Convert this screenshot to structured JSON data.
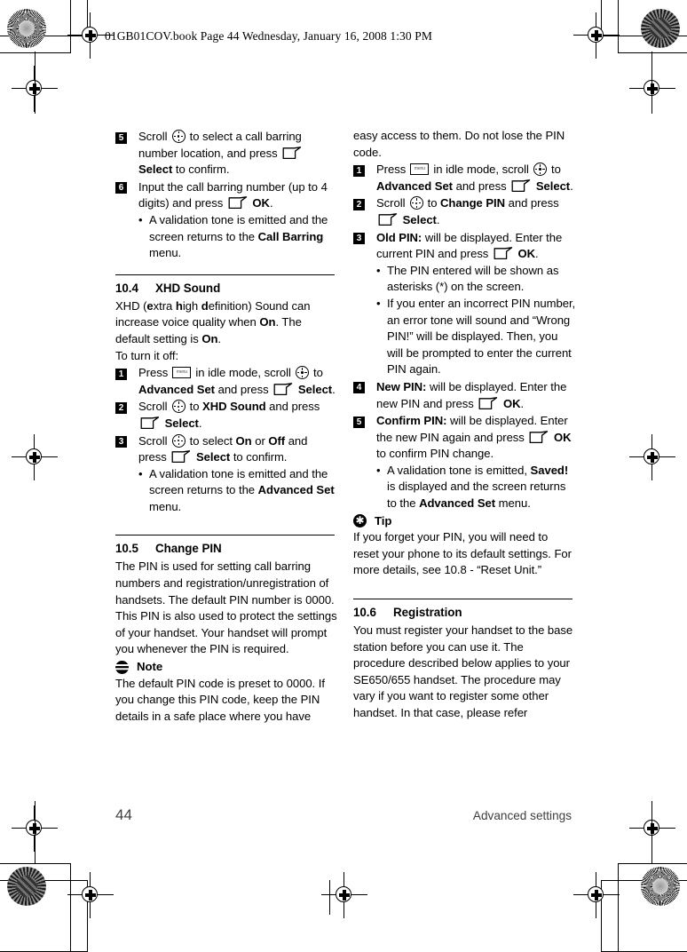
{
  "document": {
    "running_head": "01GB01COV.book  Page 44  Wednesday, January 16, 2008  1:30 PM",
    "footer": {
      "page_number": "44",
      "chapter_title": "Advanced settings"
    }
  },
  "icons": {
    "scroll": "scroll-key-icon",
    "softkey": "soft-key-icon",
    "menu": "menu-key-icon",
    "note": "note-icon",
    "tip": "tip-icon"
  },
  "left_column": {
    "step5": {
      "number": "5",
      "t1": "Scroll ",
      "t2": " to select a call barring number location, and press ",
      "t3": " ",
      "bold1": "Select",
      "t4": " to confirm."
    },
    "step6": {
      "number": "6",
      "t1": "Input the call barring number (up to 4 digits) and press ",
      "t2": " ",
      "bold1": "OK",
      "t3": ".",
      "bullet1": {
        "marker": "•",
        "t1": "A validation tone is emitted and the screen returns to the ",
        "bold1": "Call Barring",
        "t2": " menu."
      }
    },
    "section_104": {
      "number": "10.4",
      "title": "XHD Sound",
      "intro": {
        "t1": "XHD (",
        "b1": "e",
        "t2": "xtra ",
        "b2": "h",
        "t3": "igh ",
        "b3": "d",
        "t4": "efinition) Sound can increase voice quality when ",
        "b4": "On",
        "t5": ". The default setting is ",
        "b5": "On",
        "t6": "."
      },
      "lead": "To turn it off:",
      "step1": {
        "number": "1",
        "t1": "Press ",
        "t2": " in idle mode, scroll ",
        "t3": " to ",
        "bold1": "Advanced Set",
        "t4": " and press ",
        "t5": " ",
        "bold2": "Select",
        "t6": "."
      },
      "step2": {
        "number": "2",
        "t1": "Scroll ",
        "t2": " to ",
        "bold1": "XHD Sound",
        "t3": " and press ",
        "t4": " ",
        "bold2": "Select",
        "t5": "."
      },
      "step3": {
        "number": "3",
        "t1": "Scroll ",
        "t2": " to select ",
        "bold1": "On",
        "t3": " or ",
        "bold2": "Off",
        "t4": " and press ",
        "t5": " ",
        "bold3": "Select",
        "t6": " to confirm.",
        "bullet1": {
          "marker": "•",
          "t1": "A validation tone is emitted and the screen returns to the ",
          "bold1": "Advanced Set",
          "t2": " menu."
        }
      }
    },
    "section_105": {
      "number": "10.5",
      "title": "Change PIN",
      "body": "The PIN is used for setting call barring numbers and registration/unregistration of handsets. The default PIN number is 0000. This PIN is also used to protect the settings of your handset. Your handset will prompt you whenever the PIN is required.",
      "note": {
        "label": "Note",
        "body": "The default PIN code is preset to 0000. If you change this PIN code, keep the PIN details in a safe place where you have"
      }
    }
  },
  "right_column": {
    "note_continued": "easy access to them. Do not lose the PIN code.",
    "step1": {
      "number": "1",
      "t1": "Press ",
      "t2": " in idle mode, scroll ",
      "t3": " to ",
      "bold1": "Advanced Set",
      "t4": " and press ",
      "t5": " ",
      "bold2": "Select",
      "t6": "."
    },
    "step2": {
      "number": "2",
      "t1": "Scroll ",
      "t2": " to ",
      "bold1": "Change PIN",
      "t3": " and press ",
      "t4": " ",
      "bold2": "Select",
      "t5": "."
    },
    "step3": {
      "number": "3",
      "bold1": "Old PIN:",
      "t1": " will be displayed. Enter the current PIN and press ",
      "t2": " ",
      "bold2": "OK",
      "t3": ".",
      "bullet1": {
        "marker": "•",
        "text": "The PIN entered will be shown as asterisks (*) on the screen."
      },
      "bullet2": {
        "marker": "•",
        "text": "If you enter an incorrect PIN number, an error tone will sound and “Wrong PIN!” will be displayed. Then, you will be prompted to enter the current PIN again."
      }
    },
    "step4": {
      "number": "4",
      "bold1": "New PIN:",
      "t1": " will be displayed. Enter the new PIN and press ",
      "t2": " ",
      "bold2": "OK",
      "t3": "."
    },
    "step5": {
      "number": "5",
      "bold1": "Confirm PIN:",
      "t1": " will be displayed. Enter the new PIN again and press ",
      "t2": " ",
      "bold2": "OK",
      "t3": " to confirm PIN change.",
      "bullet1": {
        "marker": "•",
        "t1": "A validation tone is emitted, ",
        "bold1": "Saved!",
        "t2": " is displayed and the screen returns to the ",
        "bold2": "Advanced Set",
        "t3": " menu."
      }
    },
    "tip": {
      "label": "Tip",
      "body": "If you forget your PIN, you will need to reset your phone to its default settings. For more details, see 10.8 - “Reset Unit.”"
    },
    "section_106": {
      "number": "10.6",
      "title": "Registration",
      "body": "You must register your handset to the base station before you can use it. The procedure described below applies to your SE650/655 handset. The procedure may vary if you want to register some other handset. In that case, please refer"
    }
  }
}
